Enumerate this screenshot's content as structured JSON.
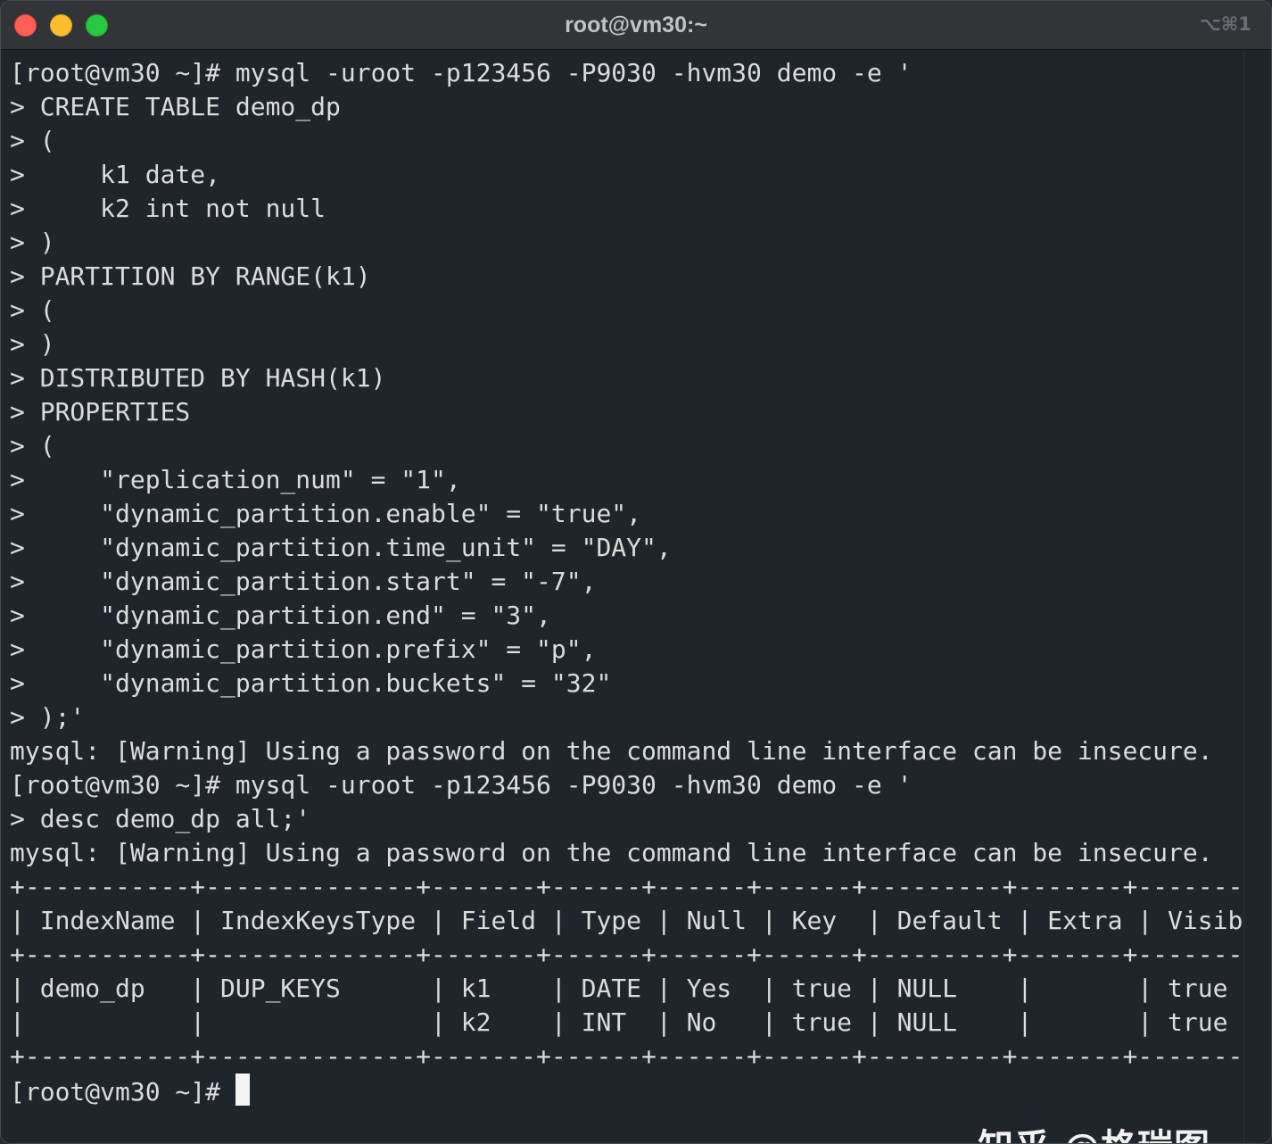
{
  "window": {
    "title": "root@vm30:~",
    "shortcut": "⌥⌘1"
  },
  "terminal": {
    "lines": [
      "[root@vm30 ~]# mysql -uroot -p123456 -P9030 -hvm30 demo -e '",
      "> CREATE TABLE demo_dp",
      "> (",
      ">     k1 date,",
      ">     k2 int not null",
      "> )",
      "> PARTITION BY RANGE(k1)",
      "> (",
      "> )",
      "> DISTRIBUTED BY HASH(k1)",
      "> PROPERTIES",
      "> (",
      ">     \"replication_num\" = \"1\",",
      ">     \"dynamic_partition.enable\" = \"true\",",
      ">     \"dynamic_partition.time_unit\" = \"DAY\",",
      ">     \"dynamic_partition.start\" = \"-7\",",
      ">     \"dynamic_partition.end\" = \"3\",",
      ">     \"dynamic_partition.prefix\" = \"p\",",
      ">     \"dynamic_partition.buckets\" = \"32\"",
      "> );'",
      "mysql: [Warning] Using a password on the command line interface can be insecure.",
      "[root@vm30 ~]# mysql -uroot -p123456 -P9030 -hvm30 demo -e '",
      "> desc demo_dp all;'",
      "mysql: [Warning] Using a password on the command line interface can be insecure.",
      "+-----------+--------------+-------+------+------+------+---------+-------+---------+",
      "| IndexName | IndexKeysType | Field | Type | Null | Key  | Default | Extra | Visible |",
      "+-----------+--------------+-------+------+------+------+---------+-------+---------+",
      "| demo_dp   | DUP_KEYS      | k1    | DATE | Yes  | true | NULL    |       | true    |",
      "|           |               | k2    | INT  | No   | true | NULL    |       | true    |",
      "+-----------+--------------+-------+------+------+------+---------+-------+---------+"
    ],
    "prompt": "[root@vm30 ~]# "
  },
  "watermark": "知乎 @格瑞图",
  "colors": {
    "background": "#1f252b",
    "text": "#dcdcdc",
    "titlebar": "#323538"
  }
}
